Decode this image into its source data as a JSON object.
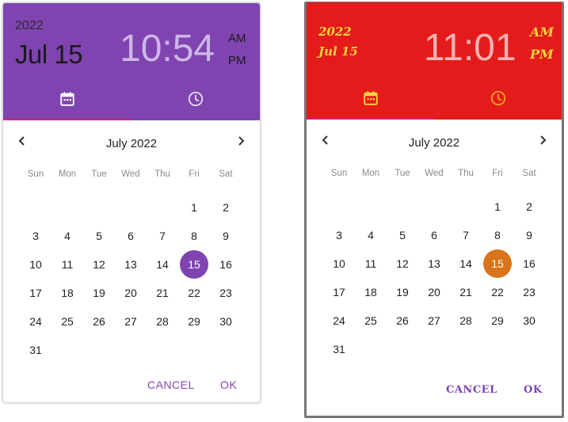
{
  "left": {
    "header": {
      "year": "2022",
      "date": "Jul 15",
      "time": "10:54",
      "am": "AM",
      "pm": "PM"
    },
    "month_title": "July 2022",
    "weekdays": [
      "Sun",
      "Mon",
      "Tue",
      "Wed",
      "Thu",
      "Fri",
      "Sat"
    ],
    "weeks": [
      [
        "",
        "",
        "",
        "",
        "",
        "1",
        "2"
      ],
      [
        "3",
        "4",
        "5",
        "6",
        "7",
        "8",
        "9"
      ],
      [
        "10",
        "11",
        "12",
        "13",
        "14",
        "15",
        "16"
      ],
      [
        "17",
        "18",
        "19",
        "20",
        "21",
        "22",
        "23"
      ],
      [
        "24",
        "25",
        "26",
        "27",
        "28",
        "29",
        "30"
      ],
      [
        "31",
        "",
        "",
        "",
        "",
        "",
        ""
      ]
    ],
    "selected_day": "15",
    "actions": {
      "cancel": "CANCEL",
      "ok": "OK"
    },
    "colors": {
      "header": "#7f44b0",
      "accent": "#7f44b0",
      "indicator": "#e2178a",
      "time_text": "#cdb6e8"
    },
    "icons": {
      "calendar_tab": "calendar-icon",
      "clock_tab": "clock-icon",
      "prev": "chevron-left-icon",
      "next": "chevron-right-icon"
    }
  },
  "right": {
    "header": {
      "year": "2022",
      "date": "Jul 15",
      "time": "11:01",
      "am": "AM",
      "pm": "PM"
    },
    "month_title": "July 2022",
    "weekdays": [
      "Sun",
      "Mon",
      "Tue",
      "Wed",
      "Thu",
      "Fri",
      "Sat"
    ],
    "weeks": [
      [
        "",
        "",
        "",
        "",
        "",
        "1",
        "2"
      ],
      [
        "3",
        "4",
        "5",
        "6",
        "7",
        "8",
        "9"
      ],
      [
        "10",
        "11",
        "12",
        "13",
        "14",
        "15",
        "16"
      ],
      [
        "17",
        "18",
        "19",
        "20",
        "21",
        "22",
        "23"
      ],
      [
        "24",
        "25",
        "26",
        "27",
        "28",
        "29",
        "30"
      ],
      [
        "31",
        "",
        "",
        "",
        "",
        "",
        ""
      ]
    ],
    "selected_day": "15",
    "actions": {
      "cancel": "CANCEL",
      "ok": "OK"
    },
    "colors": {
      "header": "#e41b1b",
      "accent": "#d8741b",
      "header_text": "#f4d43a",
      "indicator": "#e2178a",
      "time_text": "#f4b2b2",
      "buttons": "#7f44b0"
    },
    "icons": {
      "calendar_tab": "calendar-icon",
      "clock_tab": "clock-icon",
      "prev": "chevron-left-icon",
      "next": "chevron-right-icon"
    }
  }
}
